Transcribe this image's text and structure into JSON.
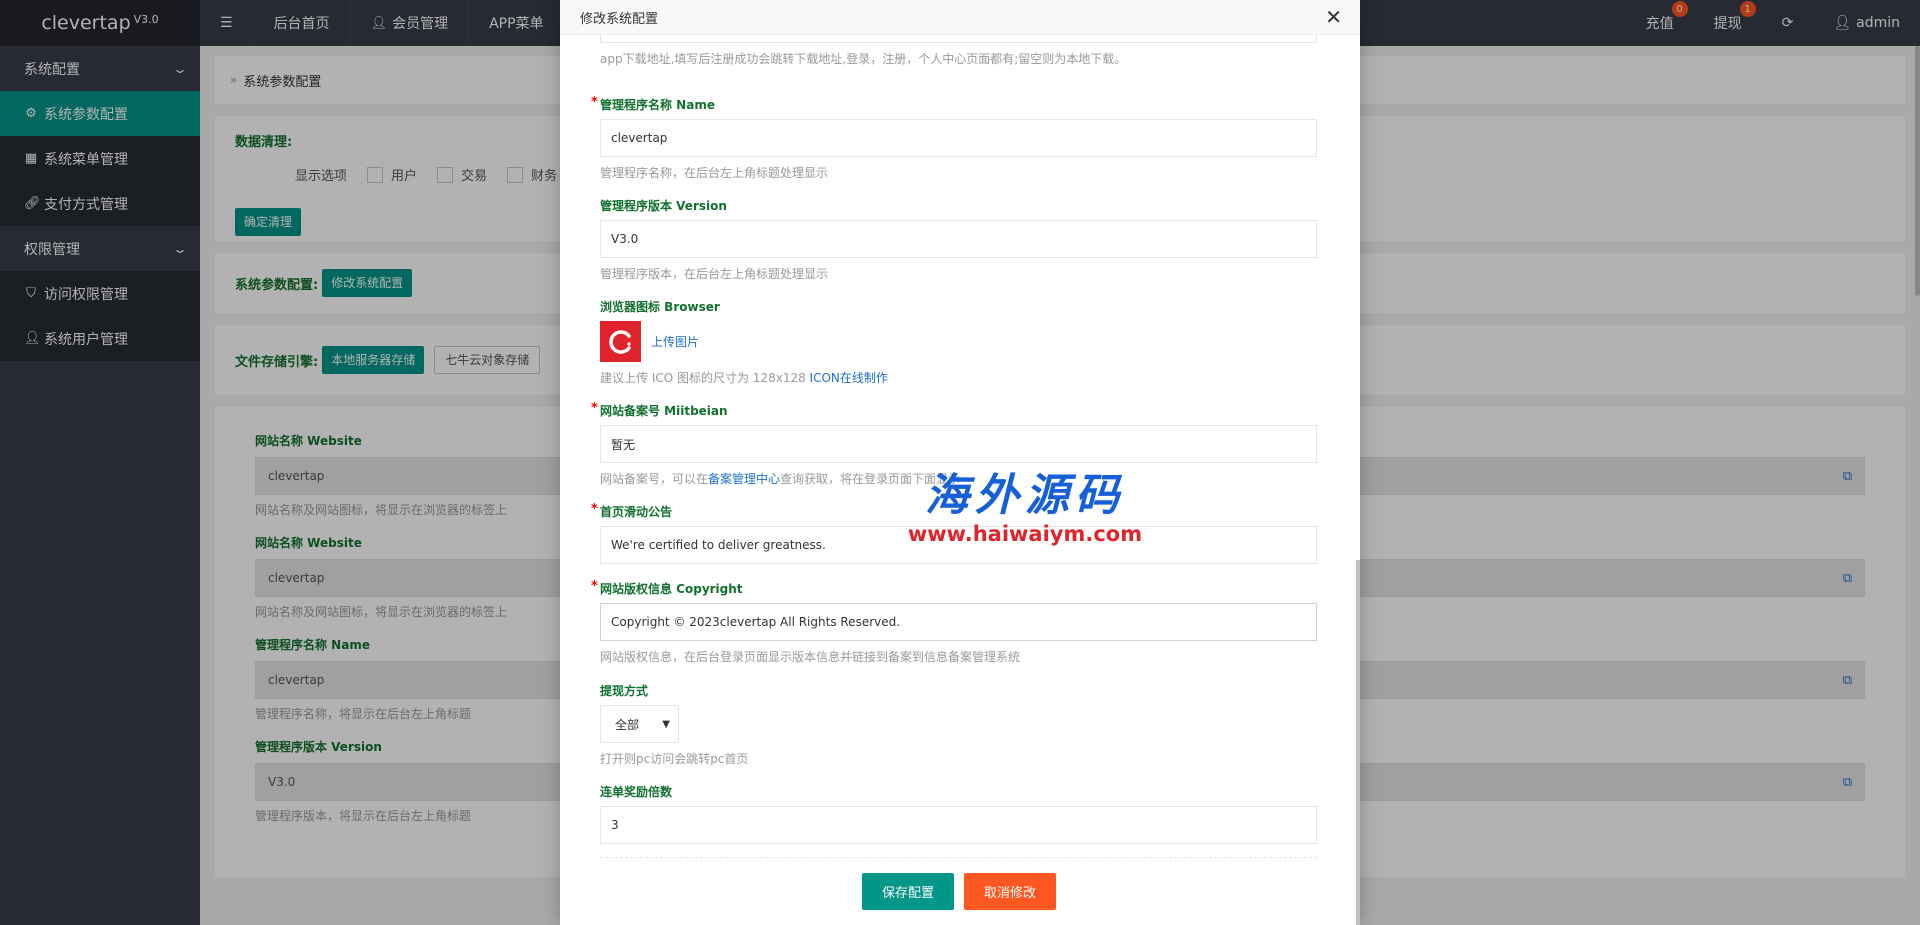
{
  "app": {
    "name": "clevertap",
    "version": "V3.0"
  },
  "topnav": {
    "menu_toggle_icon": "menu-icon",
    "items": [
      {
        "label": "后台首页"
      },
      {
        "label": "会员管理",
        "icon": "user-icon"
      },
      {
        "label": "APP菜单"
      }
    ]
  },
  "topright": {
    "recharge": {
      "label": "充值",
      "badge": "0"
    },
    "withdraw": {
      "label": "提现",
      "badge": "1"
    },
    "refresh_icon": "refresh-icon",
    "user": {
      "label": "admin",
      "icon": "user-icon"
    }
  },
  "sidebar": {
    "groups": [
      {
        "label": "系统配置",
        "items": [
          {
            "label": "系统参数配置",
            "icon": "gear-icon",
            "active": true
          },
          {
            "label": "系统菜单管理",
            "icon": "calendar-icon"
          },
          {
            "label": "支付方式管理",
            "icon": "link-icon"
          }
        ]
      },
      {
        "label": "权限管理",
        "items": [
          {
            "label": "访问权限管理",
            "icon": "shield-icon"
          },
          {
            "label": "系统用户管理",
            "icon": "user-icon"
          }
        ]
      }
    ]
  },
  "main": {
    "breadcrumb": "系统参数配置",
    "cleanup": {
      "title": "数据清理:",
      "options_label": "显示选项",
      "options": [
        "用户",
        "交易",
        "财务"
      ],
      "confirm_button": "确定清理"
    },
    "params": {
      "label": "系统参数配置:",
      "button": "修改系统配置"
    },
    "storage": {
      "label": "文件存储引擎:",
      "local": "本地服务器存储",
      "qiniu": "七牛云对象存储"
    },
    "fields": [
      {
        "label": "网站名称 Website",
        "value": "clevertap",
        "hint": "网站名称及网站图标，将显示在浏览器的标签上"
      },
      {
        "label": "网站名称 Website",
        "value": "clevertap",
        "hint": "网站名称及网站图标，将显示在浏览器的标签上"
      },
      {
        "label": "管理程序名称 Name",
        "value": "clevertap",
        "hint": "管理程序名称，将显示在后台左上角标题"
      },
      {
        "label": "管理程序版本 Version",
        "value": "V3.0",
        "hint": "管理程序版本，将显示在后台左上角标题"
      }
    ]
  },
  "modal": {
    "title": "修改系统配置",
    "close_icon": "close-icon",
    "top_hint": "app下载地址,填写后注册成功会跳转下载地址,登录，注册，个人中心页面都有;留空则为本地下载。",
    "fields": {
      "name": {
        "label": "管理程序名称 Name",
        "value": "clevertap",
        "hint": "管理程序名称，在后台左上角标题处理显示"
      },
      "version": {
        "label": "管理程序版本 Version",
        "value": "V3.0",
        "hint": "管理程序版本，在后台左上角标题处理显示"
      },
      "browser": {
        "label": "浏览器图标 Browser",
        "upload": "上传图片",
        "hint": "建议上传 ICO 图标的尺寸为 128x128 ",
        "hint_link": "ICON在线制作"
      },
      "miitbeian": {
        "label": "网站备案号 Miitbeian",
        "value": "暂无",
        "hint_pre": "网站备案号，可以在",
        "hint_link": "备案管理中心",
        "hint_post": "查询获取，将在登录页面下面显示"
      },
      "notice": {
        "label": "首页滑动公告",
        "value": "We're certified to deliver greatness."
      },
      "copyright": {
        "label": "网站版权信息 Copyright",
        "value": "Copyright © 2023clevertap All Rights Reserved.",
        "hint": "网站版权信息，在后台登录页面显示版本信息并链接到备案到信息备案管理系统"
      },
      "withdraw_mode": {
        "label": "提现方式",
        "value": "全部",
        "hint": "打开则pc访问会跳转pc首页"
      },
      "reward": {
        "label": "连单奖励倍数",
        "value": "3"
      }
    },
    "save_button": "保存配置",
    "cancel_button": "取消修改"
  },
  "watermark": {
    "cn": "海外源码",
    "url": "www.haiwaiym.com"
  },
  "colors": {
    "teal": "#009688",
    "orange": "#ff5722",
    "dark": "#393d49",
    "label_green": "#12712f",
    "link_blue": "#1e6fd0"
  }
}
